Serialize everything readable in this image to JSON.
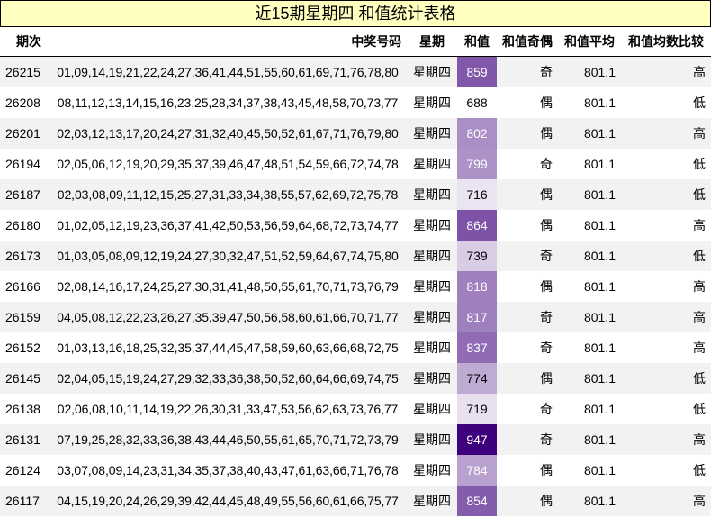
{
  "title": "近15期星期四 和值统计表格",
  "headers": {
    "issue": "期次",
    "numbers": "中奖号码",
    "weekday": "星期",
    "sum": "和值",
    "parity": "和值奇偶",
    "average": "和值平均",
    "compare": "和值均数比较"
  },
  "sum_color_scale": {
    "min": 688,
    "max": 947,
    "low_color": "#ffffff",
    "high_color": "#3f007d"
  },
  "rows": [
    {
      "issue": "26215",
      "numbers": "01,09,14,19,21,22,24,27,36,41,44,51,55,60,61,69,71,76,78,80",
      "weekday": "星期四",
      "sum": "859",
      "parity": "奇",
      "average": "801.1",
      "compare": "高"
    },
    {
      "issue": "26208",
      "numbers": "08,11,12,13,14,15,16,23,25,28,34,37,38,43,45,48,58,70,73,77",
      "weekday": "星期四",
      "sum": "688",
      "parity": "偶",
      "average": "801.1",
      "compare": "低"
    },
    {
      "issue": "26201",
      "numbers": "02,03,12,13,17,20,24,27,31,32,40,45,50,52,61,67,71,76,79,80",
      "weekday": "星期四",
      "sum": "802",
      "parity": "偶",
      "average": "801.1",
      "compare": "高"
    },
    {
      "issue": "26194",
      "numbers": "02,05,06,12,19,20,29,35,37,39,46,47,48,51,54,59,66,72,74,78",
      "weekday": "星期四",
      "sum": "799",
      "parity": "奇",
      "average": "801.1",
      "compare": "低"
    },
    {
      "issue": "26187",
      "numbers": "02,03,08,09,11,12,15,25,27,31,33,34,38,55,57,62,69,72,75,78",
      "weekday": "星期四",
      "sum": "716",
      "parity": "偶",
      "average": "801.1",
      "compare": "低"
    },
    {
      "issue": "26180",
      "numbers": "01,02,05,12,19,23,36,37,41,42,50,53,56,59,64,68,72,73,74,77",
      "weekday": "星期四",
      "sum": "864",
      "parity": "偶",
      "average": "801.1",
      "compare": "高"
    },
    {
      "issue": "26173",
      "numbers": "01,03,05,08,09,12,19,24,27,30,32,47,51,52,59,64,67,74,75,80",
      "weekday": "星期四",
      "sum": "739",
      "parity": "奇",
      "average": "801.1",
      "compare": "低"
    },
    {
      "issue": "26166",
      "numbers": "02,08,14,16,17,24,25,27,30,31,41,48,50,55,61,70,71,73,76,79",
      "weekday": "星期四",
      "sum": "818",
      "parity": "偶",
      "average": "801.1",
      "compare": "高"
    },
    {
      "issue": "26159",
      "numbers": "04,05,08,12,22,23,26,27,35,39,47,50,56,58,60,61,66,70,71,77",
      "weekday": "星期四",
      "sum": "817",
      "parity": "奇",
      "average": "801.1",
      "compare": "高"
    },
    {
      "issue": "26152",
      "numbers": "01,03,13,16,18,25,32,35,37,44,45,47,58,59,60,63,66,68,72,75",
      "weekday": "星期四",
      "sum": "837",
      "parity": "奇",
      "average": "801.1",
      "compare": "高"
    },
    {
      "issue": "26145",
      "numbers": "02,04,05,15,19,24,27,29,32,33,36,38,50,52,60,64,66,69,74,75",
      "weekday": "星期四",
      "sum": "774",
      "parity": "偶",
      "average": "801.1",
      "compare": "低"
    },
    {
      "issue": "26138",
      "numbers": "02,06,08,10,11,14,19,22,26,30,31,33,47,53,56,62,63,73,76,77",
      "weekday": "星期四",
      "sum": "719",
      "parity": "奇",
      "average": "801.1",
      "compare": "低"
    },
    {
      "issue": "26131",
      "numbers": "07,19,25,28,32,33,36,38,43,44,46,50,55,61,65,70,71,72,73,79",
      "weekday": "星期四",
      "sum": "947",
      "parity": "奇",
      "average": "801.1",
      "compare": "高"
    },
    {
      "issue": "26124",
      "numbers": "03,07,08,09,14,23,31,34,35,37,38,40,43,47,61,63,66,71,76,78",
      "weekday": "星期四",
      "sum": "784",
      "parity": "偶",
      "average": "801.1",
      "compare": "低"
    },
    {
      "issue": "26117",
      "numbers": "04,15,19,20,24,26,29,39,42,44,45,48,49,55,56,60,61,66,75,77",
      "weekday": "星期四",
      "sum": "854",
      "parity": "偶",
      "average": "801.1",
      "compare": "高"
    }
  ]
}
